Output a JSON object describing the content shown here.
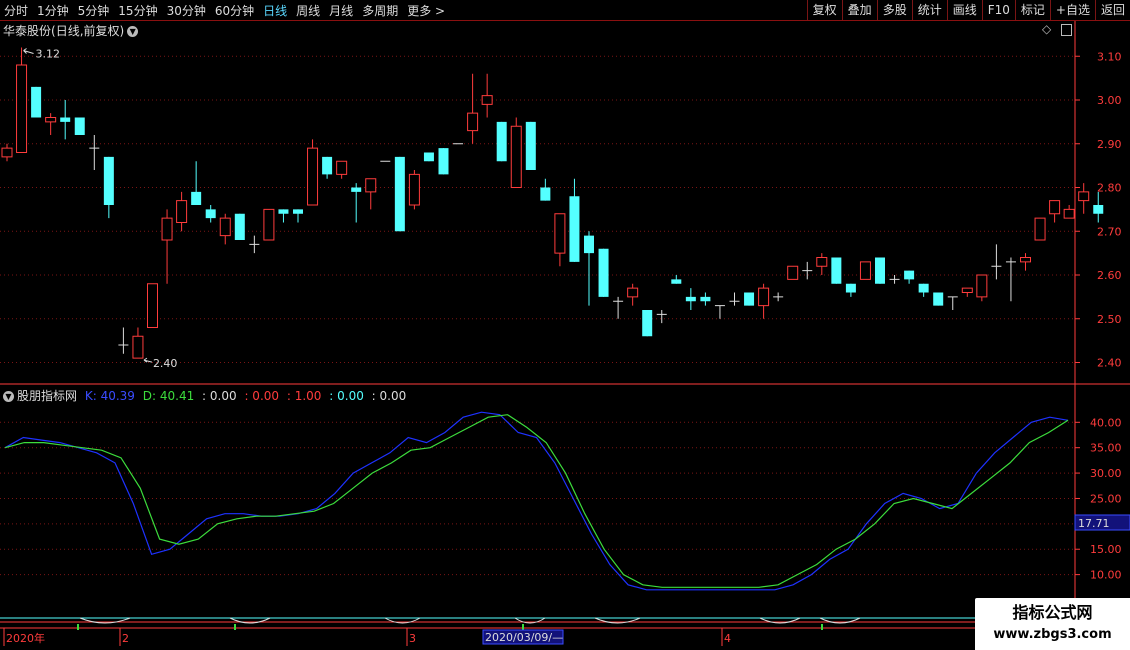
{
  "toolbar": {
    "left": [
      {
        "label": "分时",
        "active": false
      },
      {
        "label": "1分钟",
        "active": false
      },
      {
        "label": "5分钟",
        "active": false
      },
      {
        "label": "15分钟",
        "active": false
      },
      {
        "label": "30分钟",
        "active": false
      },
      {
        "label": "60分钟",
        "active": false
      },
      {
        "label": "日线",
        "active": true
      },
      {
        "label": "周线",
        "active": false
      },
      {
        "label": "月线",
        "active": false
      },
      {
        "label": "多周期",
        "active": false
      },
      {
        "label": "更多 >",
        "active": false
      }
    ],
    "right": [
      "复权",
      "叠加",
      "多股",
      "统计",
      "画线",
      "F10",
      "标记",
      "+自选",
      "返回"
    ]
  },
  "header": {
    "stock": "华泰股份",
    "period": "(日线,前复权)"
  },
  "indicator": {
    "name": "股朋指标网",
    "k_label": "K: 40.39",
    "d_label": "D: 40.41",
    "v1": ": 0.00",
    "v2": ": 0.00",
    "v3": ": 1.00",
    "v4": ": 0.00",
    "v5": ": 0.00"
  },
  "crosshair_value": "17.71",
  "xaxis": {
    "year": "2020年",
    "m2": "2",
    "m3": "3",
    "date": "2020/03/09/—",
    "m4": "4"
  },
  "watermark": {
    "line1": "指标公式网",
    "line2": "www.zbgs3.com"
  },
  "colors": {
    "up": "#ff3c3c",
    "down": "#54ffff",
    "k": "#1e32ff",
    "d": "#3cdc3c",
    "grid": "#7a1515",
    "axis": "#ff3c3c"
  },
  "chart_data": [
    {
      "type": "candlestick",
      "title": "华泰股份(日线,前复权)",
      "ylim": [
        2.36,
        3.16
      ],
      "yticks": [
        2.4,
        2.5,
        2.6,
        2.7,
        2.8,
        2.9,
        3.0,
        3.1
      ],
      "annotations": {
        "high": "3.12",
        "low": "2.40"
      },
      "candles": [
        [
          2.87,
          2.9,
          2.86,
          2.89
        ],
        [
          2.88,
          3.12,
          2.88,
          3.08
        ],
        [
          3.03,
          3.03,
          2.96,
          2.96
        ],
        [
          2.95,
          2.97,
          2.92,
          2.96
        ],
        [
          2.96,
          3.0,
          2.91,
          2.95
        ],
        [
          2.96,
          2.96,
          2.92,
          2.92
        ],
        [
          2.89,
          2.92,
          2.84,
          2.89
        ],
        [
          2.87,
          2.87,
          2.73,
          2.76
        ],
        [
          2.44,
          2.48,
          2.42,
          2.44
        ],
        [
          2.41,
          2.48,
          2.41,
          2.46
        ],
        [
          2.48,
          2.58,
          2.48,
          2.58
        ],
        [
          2.68,
          2.75,
          2.58,
          2.73
        ],
        [
          2.72,
          2.79,
          2.7,
          2.77
        ],
        [
          2.79,
          2.86,
          2.76,
          2.76
        ],
        [
          2.75,
          2.76,
          2.72,
          2.73
        ],
        [
          2.69,
          2.74,
          2.67,
          2.73
        ],
        [
          2.74,
          2.74,
          2.68,
          2.68
        ],
        [
          2.67,
          2.69,
          2.65,
          2.67
        ],
        [
          2.68,
          2.75,
          2.68,
          2.75
        ],
        [
          2.75,
          2.75,
          2.72,
          2.74
        ],
        [
          2.75,
          2.75,
          2.72,
          2.74
        ],
        [
          2.76,
          2.91,
          2.76,
          2.89
        ],
        [
          2.87,
          2.87,
          2.82,
          2.83
        ],
        [
          2.83,
          2.86,
          2.82,
          2.86
        ],
        [
          2.8,
          2.81,
          2.72,
          2.79
        ],
        [
          2.79,
          2.82,
          2.75,
          2.82
        ],
        [
          2.86,
          2.86,
          2.86,
          2.86
        ],
        [
          2.87,
          2.87,
          2.7,
          2.7
        ],
        [
          2.76,
          2.84,
          2.75,
          2.83
        ],
        [
          2.88,
          2.88,
          2.86,
          2.86
        ],
        [
          2.89,
          2.89,
          2.83,
          2.83
        ],
        [
          2.9,
          2.9,
          2.9,
          2.9
        ],
        [
          2.93,
          3.06,
          2.9,
          2.97
        ],
        [
          2.99,
          3.06,
          2.96,
          3.01
        ],
        [
          2.95,
          2.95,
          2.86,
          2.86
        ],
        [
          2.8,
          2.96,
          2.8,
          2.94
        ],
        [
          2.95,
          2.95,
          2.84,
          2.84
        ],
        [
          2.8,
          2.82,
          2.77,
          2.77
        ],
        [
          2.65,
          2.74,
          2.62,
          2.74
        ],
        [
          2.78,
          2.82,
          2.63,
          2.63
        ],
        [
          2.69,
          2.7,
          2.53,
          2.65
        ],
        [
          2.66,
          2.66,
          2.55,
          2.55
        ],
        [
          2.54,
          2.55,
          2.5,
          2.54
        ],
        [
          2.55,
          2.58,
          2.53,
          2.57
        ],
        [
          2.52,
          2.52,
          2.46,
          2.46
        ],
        [
          2.51,
          2.52,
          2.49,
          2.51
        ],
        [
          2.59,
          2.6,
          2.58,
          2.58
        ],
        [
          2.55,
          2.57,
          2.52,
          2.54
        ],
        [
          2.55,
          2.56,
          2.53,
          2.54
        ],
        [
          2.53,
          2.53,
          2.5,
          2.53
        ],
        [
          2.54,
          2.56,
          2.53,
          2.54
        ],
        [
          2.56,
          2.56,
          2.53,
          2.53
        ],
        [
          2.53,
          2.58,
          2.5,
          2.57
        ],
        [
          2.55,
          2.56,
          2.54,
          2.55
        ],
        [
          2.59,
          2.62,
          2.59,
          2.62
        ],
        [
          2.61,
          2.63,
          2.59,
          2.61
        ],
        [
          2.62,
          2.65,
          2.6,
          2.64
        ],
        [
          2.64,
          2.64,
          2.58,
          2.58
        ],
        [
          2.58,
          2.58,
          2.55,
          2.56
        ],
        [
          2.59,
          2.63,
          2.59,
          2.63
        ],
        [
          2.64,
          2.64,
          2.58,
          2.58
        ],
        [
          2.59,
          2.6,
          2.58,
          2.59
        ],
        [
          2.61,
          2.61,
          2.58,
          2.59
        ],
        [
          2.58,
          2.58,
          2.55,
          2.56
        ],
        [
          2.56,
          2.56,
          2.53,
          2.53
        ],
        [
          2.55,
          2.55,
          2.52,
          2.55
        ],
        [
          2.56,
          2.57,
          2.55,
          2.57
        ],
        [
          2.55,
          2.6,
          2.54,
          2.6
        ],
        [
          2.62,
          2.67,
          2.59,
          2.62
        ],
        [
          2.63,
          2.64,
          2.54,
          2.63
        ],
        [
          2.63,
          2.65,
          2.61,
          2.64
        ],
        [
          2.68,
          2.72,
          2.68,
          2.73
        ],
        [
          2.74,
          2.76,
          2.72,
          2.77
        ],
        [
          2.73,
          2.76,
          2.73,
          2.75
        ],
        [
          2.77,
          2.81,
          2.74,
          2.79
        ],
        [
          2.76,
          2.79,
          2.72,
          2.74
        ]
      ]
    },
    {
      "type": "line",
      "title": "股朋指标网",
      "ylim": [
        5,
        44
      ],
      "yticks": [
        10,
        15,
        20,
        25,
        30,
        35,
        40
      ],
      "series": [
        {
          "name": "K",
          "values": [
            35,
            37,
            36.5,
            36,
            35,
            34,
            32,
            24,
            14,
            15,
            18,
            21,
            22,
            22,
            21.5,
            21.5,
            22,
            23,
            26,
            30,
            32,
            34,
            37,
            36,
            38,
            41,
            42,
            41.5,
            38,
            37,
            32,
            25,
            18,
            12,
            8,
            7,
            7,
            7,
            7,
            7,
            7,
            7,
            7,
            8,
            10,
            13,
            15,
            20,
            24,
            26,
            25,
            23,
            24,
            30,
            34,
            37,
            40,
            41,
            40.39
          ]
        },
        {
          "name": "D",
          "values": [
            35,
            36,
            36,
            35.5,
            35,
            34.5,
            33,
            27,
            17,
            16,
            17,
            20,
            21,
            21.5,
            21.5,
            22,
            22.5,
            24,
            27,
            30,
            32,
            34.5,
            35,
            37,
            39,
            41,
            41.5,
            39,
            36,
            30,
            22,
            15,
            10,
            8,
            7.5,
            7.5,
            7.5,
            7.5,
            7.5,
            7.5,
            8,
            10,
            12,
            15,
            17,
            20,
            24,
            25,
            24,
            23,
            26,
            29,
            32,
            36,
            38,
            40.41
          ]
        }
      ]
    }
  ]
}
